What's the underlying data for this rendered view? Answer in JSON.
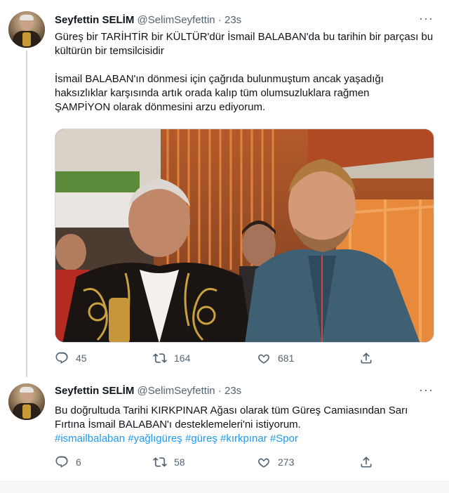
{
  "tweets": [
    {
      "name": "Seyfettin SELİM",
      "handle": "@SelimSeyfettin",
      "separator": "·",
      "time": "23s",
      "more": "···",
      "paragraph1": "Güreş bir TARİHTİR bir KÜLTÜR'dür İsmail BALABAN'da bu tarihin bir parçası bu kültürün bir temsilcisidir",
      "paragraph2_line1": "İsmail BALABAN'ın dönmesi için çağrıda bulunmuştum ancak yaşadığı",
      "paragraph2_line2": "haksızlıklar karşısında artık orada kalıp tüm olumsuzluklara rağmen",
      "paragraph2_line3": "ŞAMPİYON olarak dönmesini arzu ediyorum.",
      "replies": "45",
      "retweets": "164",
      "likes": "681"
    },
    {
      "name": "Seyfettin SELİM",
      "handle": "@SelimSeyfettin",
      "separator": "·",
      "time": "23s",
      "more": "···",
      "line1": "Bu doğrultuda Tarihi KIRKPINAR Ağası olarak tüm Güreş Camiasından Sarı",
      "line2": "Fırtına İsmail BALABAN'ı desteklemeleri'ni istiyorum.",
      "hashtags": [
        "#ismailbalaban",
        "#yağlıgüreş",
        "#güreş",
        "#kırkpınar",
        "#Spor"
      ],
      "replies": "6",
      "retweets": "58",
      "likes": "273"
    }
  ],
  "icons": {
    "reply": "reply-icon",
    "retweet": "retweet-icon",
    "like": "heart-icon",
    "share": "share-icon"
  },
  "colors": {
    "accent": "#1d9bf0",
    "text": "#0f1419",
    "muted": "#536471"
  }
}
